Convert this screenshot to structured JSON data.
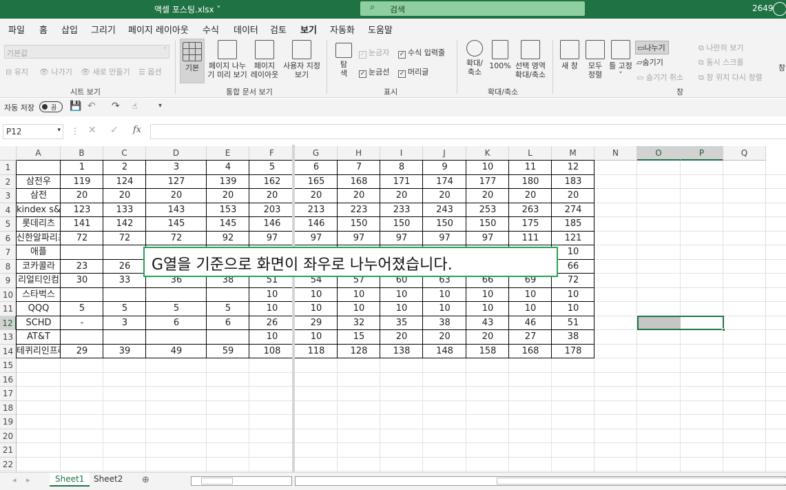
{
  "title_bar": {
    "file_name": "액셀 포스팅.xlsx ˅",
    "search_placeholder": "검색",
    "user_id": "2649"
  },
  "tabs": [
    "파일",
    "홈",
    "삽입",
    "그리기",
    "페이지 레이아웃",
    "수식",
    "데이터",
    "검토",
    "보기",
    "자동화",
    "도움말"
  ],
  "active_tab": "보기",
  "ribbon": {
    "sheet_view": {
      "dropdown": "기본값",
      "keep": "유지",
      "exit": "나가기",
      "new": "새로 만들기",
      "options": "옵션",
      "label": "시트 보기"
    },
    "workbook_views": {
      "normal": "기본",
      "page_break_1": "페이지 나누",
      "page_break_2": "기 미리 보기",
      "page_layout_1": "페이지",
      "page_layout_2": "레이아웃",
      "custom_1": "사용자 지정",
      "custom_2": "보기",
      "label": "통합 문서 보기"
    },
    "show": {
      "nav_1": "탐",
      "nav_2": "색",
      "ruler": "눈금자",
      "formula_bar": "수식 입력줄",
      "gridlines": "눈금선",
      "headings": "머리글",
      "label": "표시"
    },
    "zoom": {
      "zoom_1": "확대/",
      "zoom_2": "축소",
      "hundred": "100%",
      "sel_1": "선택 영역",
      "sel_2": "확대/축소",
      "label": "확대/축소"
    },
    "window": {
      "new_window": "새 창",
      "arrange_1": "모두",
      "arrange_2": "정렬",
      "freeze_1": "틀 고정",
      "freeze_2": "˅",
      "split": "나누기",
      "hide": "숨기기",
      "unhide": "숨기기 취소",
      "side_by_side": "나란히 보기",
      "sync_scroll": "동시 스크롤",
      "reset_pos": "창 위치 다시 정렬",
      "switch": "창",
      "label": "창"
    }
  },
  "qat": {
    "autosave_label": "자동 저장",
    "autosave_state": "끔"
  },
  "formula_bar": {
    "name_box": "P12",
    "fx": "fx"
  },
  "columns": [
    "A",
    "B",
    "C",
    "D",
    "E",
    "F",
    "G",
    "H",
    "I",
    "J",
    "K",
    "L",
    "M",
    "N",
    "O",
    "P",
    "Q"
  ],
  "row_numbers": [
    "1",
    "2",
    "3",
    "4",
    "5",
    "6",
    "7",
    "8",
    "9",
    "10",
    "11",
    "12",
    "13",
    "14",
    "15",
    "16",
    "17",
    "18",
    "19",
    "20",
    "21",
    "22"
  ],
  "rows": [
    [
      "",
      "1",
      "2",
      "3",
      "4",
      "5",
      "6",
      "7",
      "8",
      "9",
      "10",
      "11",
      "12"
    ],
    [
      "삼전우",
      "119",
      "124",
      "127",
      "139",
      "162",
      "165",
      "168",
      "171",
      "174",
      "177",
      "180",
      "183"
    ],
    [
      "삼전",
      "20",
      "20",
      "20",
      "20",
      "20",
      "20",
      "20",
      "20",
      "20",
      "20",
      "20",
      "20"
    ],
    [
      "kindex s&p",
      "123",
      "133",
      "143",
      "153",
      "203",
      "213",
      "223",
      "233",
      "243",
      "253",
      "263",
      "274"
    ],
    [
      "롯데리츠",
      "141",
      "142",
      "145",
      "145",
      "146",
      "146",
      "150",
      "150",
      "150",
      "150",
      "175",
      "185"
    ],
    [
      "신한알파리츠",
      "72",
      "72",
      "72",
      "92",
      "97",
      "97",
      "97",
      "97",
      "97",
      "97",
      "111",
      "121"
    ],
    [
      "애플",
      "",
      "",
      "",
      "",
      "",
      "",
      "",
      "",
      "",
      "",
      "",
      "10"
    ],
    [
      "코카콜라",
      "23",
      "26",
      "",
      "",
      "",
      "",
      "",
      "",
      "",
      "",
      "",
      "66"
    ],
    [
      "리얼티인컴",
      "30",
      "33",
      "36",
      "38",
      "51",
      "54",
      "57",
      "60",
      "63",
      "66",
      "69",
      "72"
    ],
    [
      "스타벅스",
      "",
      "",
      "",
      "",
      "10",
      "10",
      "10",
      "10",
      "10",
      "10",
      "10",
      "10"
    ],
    [
      "QQQ",
      "5",
      "5",
      "5",
      "5",
      "10",
      "10",
      "10",
      "10",
      "10",
      "10",
      "10",
      "10"
    ],
    [
      "SCHD",
      "-",
      "3",
      "6",
      "6",
      "26",
      "29",
      "32",
      "35",
      "38",
      "43",
      "46",
      "51"
    ],
    [
      "AT&T",
      "",
      "",
      "",
      "",
      "10",
      "10",
      "15",
      "20",
      "20",
      "20",
      "27",
      "38"
    ],
    [
      "테퀴리인프라",
      "29",
      "39",
      "49",
      "59",
      "108",
      "118",
      "128",
      "138",
      "148",
      "158",
      "168",
      "178"
    ]
  ],
  "callout": "G열을 기준으로 화면이 좌우로 나누어졌습니다.",
  "sheets": [
    "Sheet1",
    "Sheet2"
  ],
  "active_sheet": "Sheet1",
  "accent_color": "#1f7244"
}
